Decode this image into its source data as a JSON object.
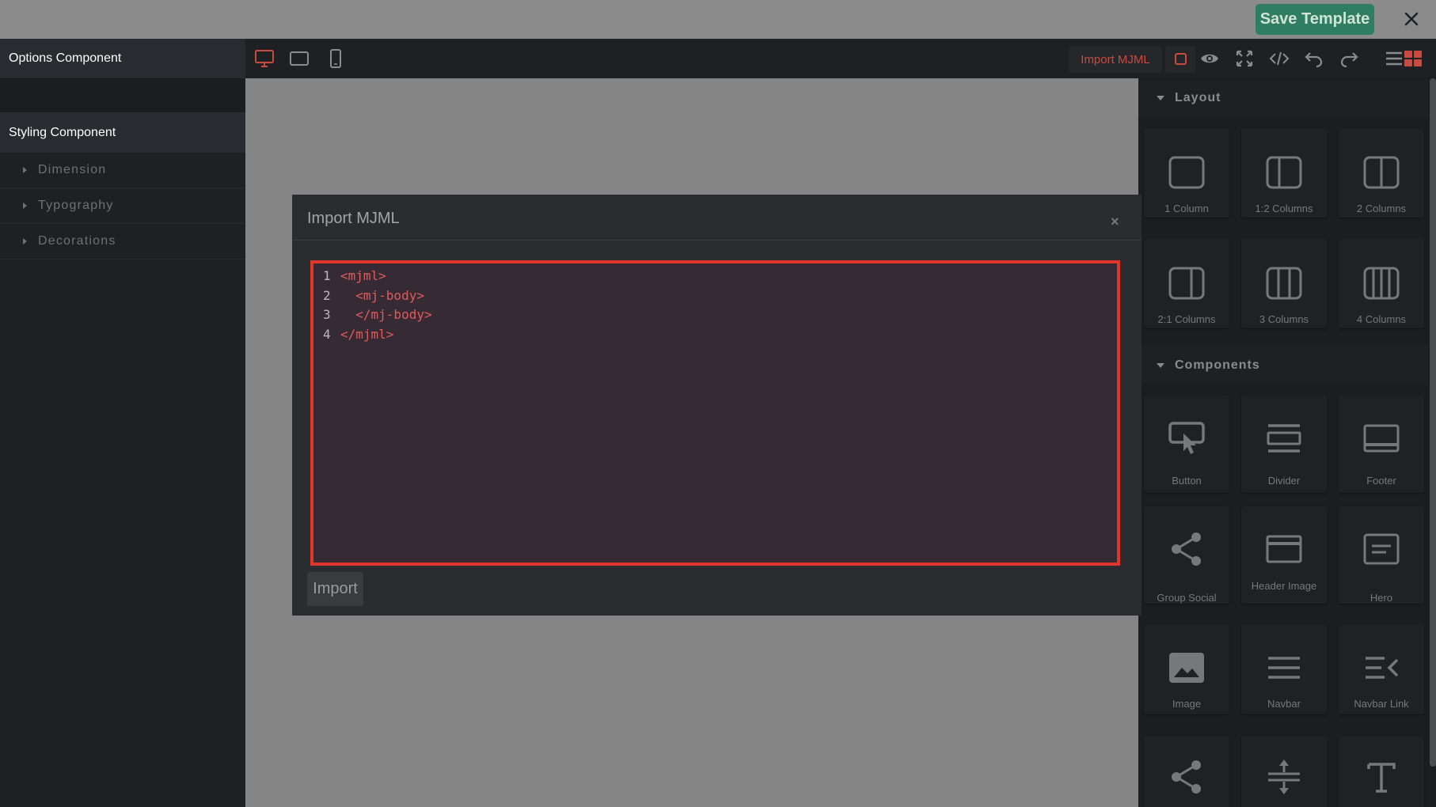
{
  "topbar": {
    "save_label": "Save Template",
    "close_icon": "close-icon"
  },
  "left_panel": {
    "options_header": "Options Component",
    "styling_header": "Styling Component",
    "sections": [
      {
        "label": "Dimension"
      },
      {
        "label": "Typography"
      },
      {
        "label": "Decorations"
      }
    ]
  },
  "toolbar": {
    "devices": [
      "desktop-icon",
      "tablet-icon",
      "mobile-icon"
    ],
    "import_label": "Import MJML",
    "actions": [
      "sw-visibility-icon",
      "preview-icon",
      "fullscreen-icon",
      "code-icon",
      "undo-icon",
      "redo-icon"
    ],
    "accent_color": "#c94a3f"
  },
  "right_panel": {
    "layout_title": "Layout",
    "layout_blocks": [
      {
        "label": "1 Column"
      },
      {
        "label": "1:2 Columns"
      },
      {
        "label": "2 Columns"
      },
      {
        "label": "2:1 Columns"
      },
      {
        "label": "3 Columns"
      },
      {
        "label": "4 Columns"
      }
    ],
    "components_title": "Components",
    "component_blocks": [
      {
        "label": "Button"
      },
      {
        "label": "Divider"
      },
      {
        "label": "Footer"
      },
      {
        "label": "Group Social"
      },
      {
        "label": "Header Image"
      },
      {
        "label": "Hero"
      },
      {
        "label": "Image"
      },
      {
        "label": "Navbar"
      },
      {
        "label": "Navbar Link"
      }
    ]
  },
  "modal": {
    "title": "Import MJML",
    "close_label": "×",
    "code_lines": [
      {
        "num": "1",
        "code": "<mjml>"
      },
      {
        "num": "2",
        "code": "  <mj-body>"
      },
      {
        "num": "3",
        "code": "  </mj-body>"
      },
      {
        "num": "4",
        "code": "</mjml>"
      }
    ],
    "import_label": "Import"
  }
}
